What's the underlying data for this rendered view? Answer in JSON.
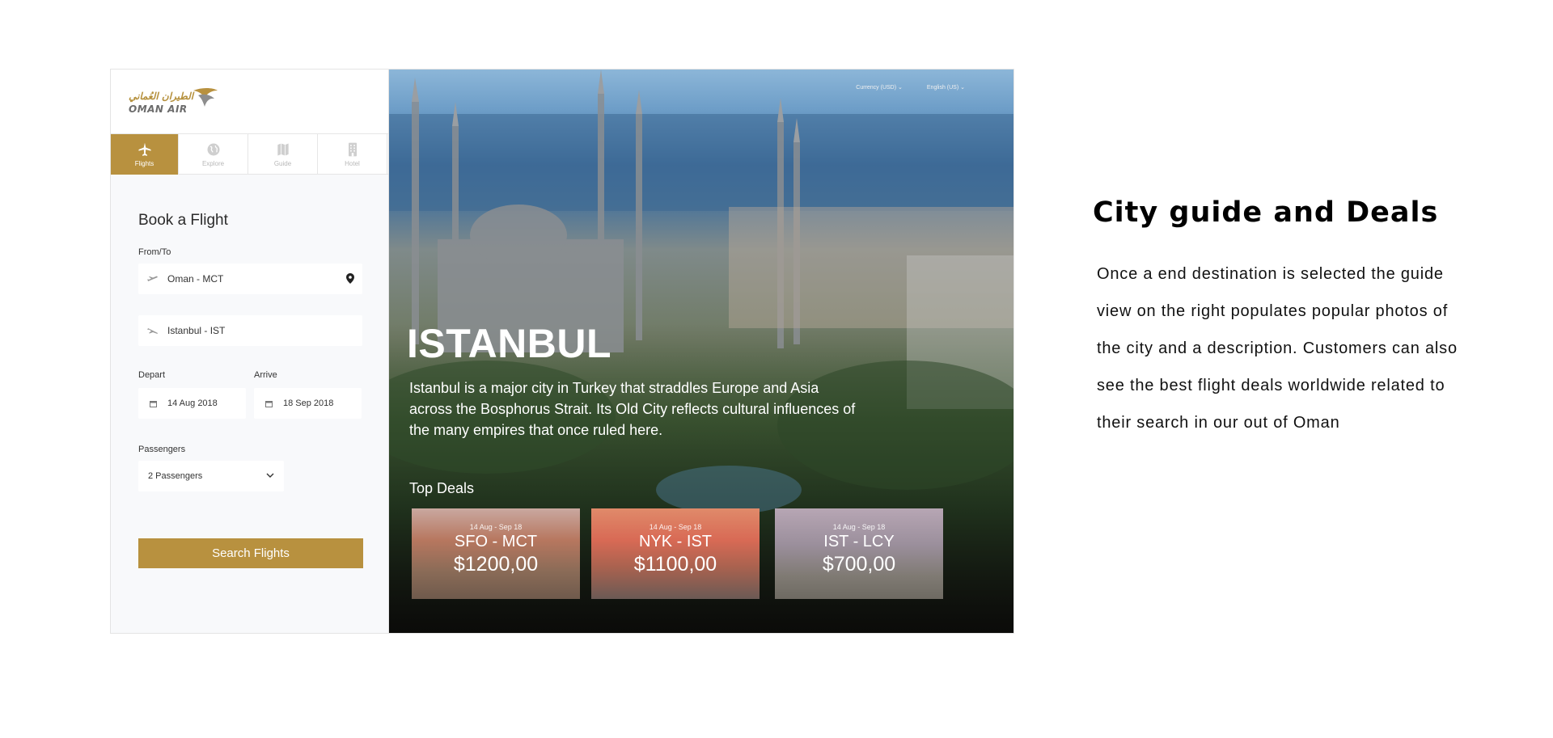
{
  "brand": {
    "arabic": "الطيران العُماني",
    "name": "OMAN AIR",
    "gold": "#b8913f"
  },
  "tabs": [
    {
      "label": "Flights",
      "icon": "plane-icon",
      "active": true
    },
    {
      "label": "Explore",
      "icon": "globe-icon",
      "active": false
    },
    {
      "label": "Guide",
      "icon": "map-icon",
      "active": false
    },
    {
      "label": "Hotel",
      "icon": "building-icon",
      "active": false
    }
  ],
  "form": {
    "title": "Book a Flight",
    "from_to_label": "From/To",
    "from": "Oman - MCT",
    "to": "Istanbul - IST",
    "depart_label": "Depart",
    "arrive_label": "Arrive",
    "depart": "14 Aug 2018",
    "arrive": "18 Sep 2018",
    "passengers_label": "Passengers",
    "passengers": "2 Passengers",
    "search_label": "Search Flights"
  },
  "hero": {
    "currency": "Currency (USD)",
    "language": "English (US)",
    "city": "ISTANBUL",
    "description": "Istanbul is a major city in Turkey that straddles Europe and Asia across the Bosphorus Strait. Its Old City reflects cultural influences of the many empires that once ruled here.",
    "deals_title": "Top Deals",
    "deals": [
      {
        "dates": "14 Aug - Sep 18",
        "route": "SFO - MCT",
        "price": "$1200,00"
      },
      {
        "dates": "14 Aug - Sep 18",
        "route": "NYK - IST",
        "price": "$1100,00"
      },
      {
        "dates": "14 Aug - Sep 18",
        "route": "IST - LCY",
        "price": "$700,00"
      }
    ]
  },
  "side": {
    "title": "City guide and Deals",
    "body": "Once a end destination is selected the guide view on the right populates popular photos of the city and a description. Customers can also see the best flight deals worldwide related to their search in our out of Oman"
  }
}
